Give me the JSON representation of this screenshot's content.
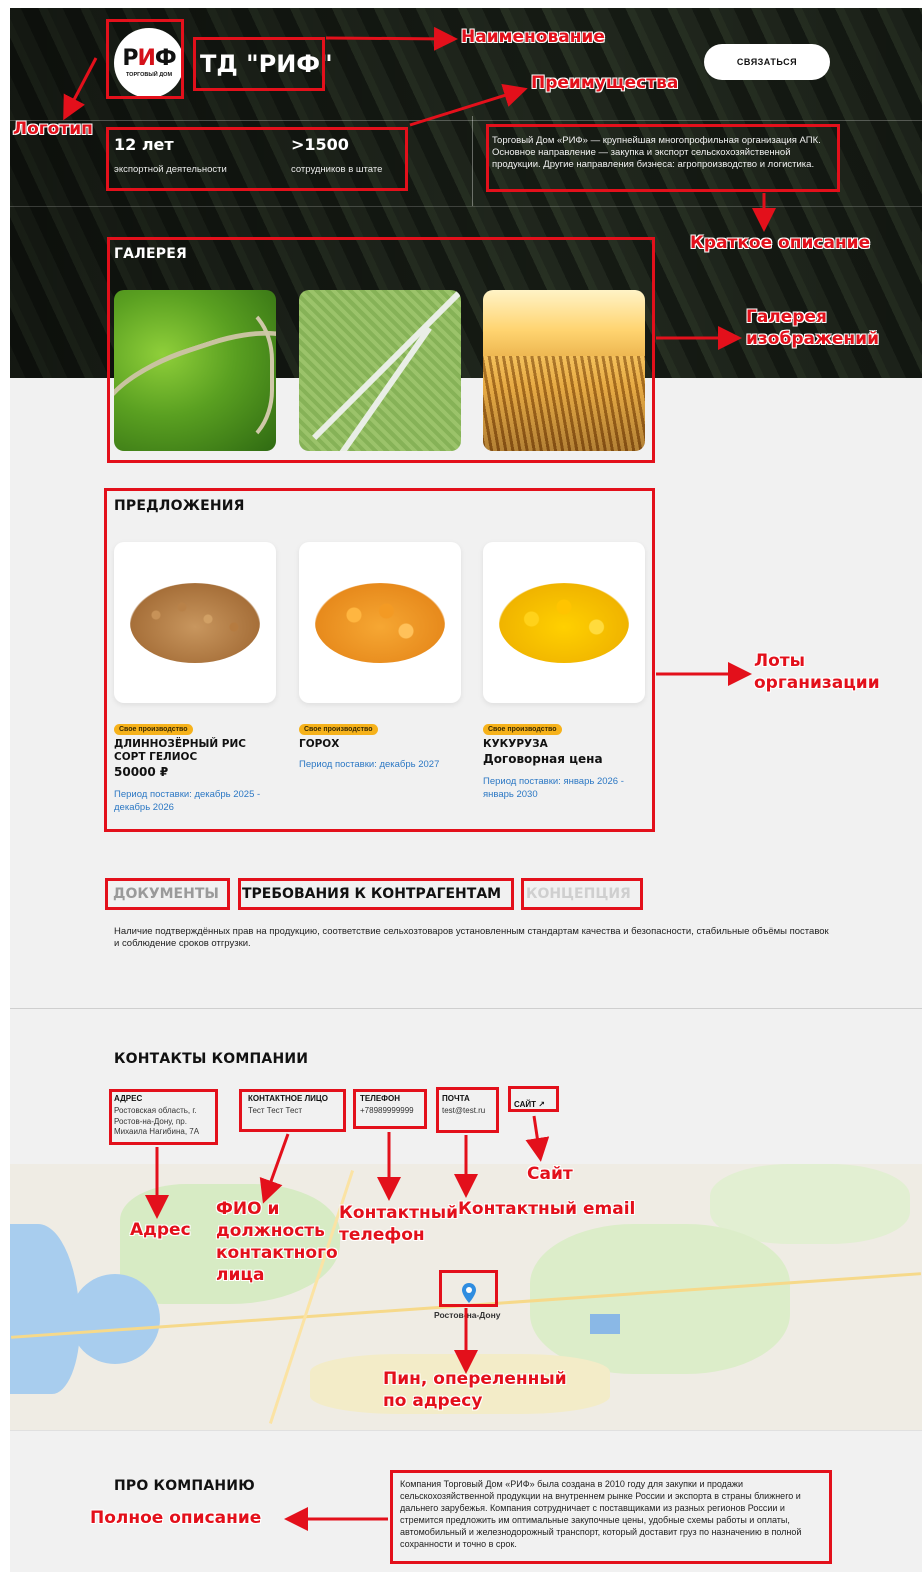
{
  "company": {
    "logo_mark_left": "Р",
    "logo_mark_mid": "И",
    "logo_mark_right": "Ф",
    "logo_subtitle": "ТОРГОВЫЙ ДОМ",
    "name": "ТД \"РИФ\"",
    "contact_button": "СВЯЗАТЬСЯ",
    "short_description": "Торговый Дом «РИФ» — крупнейшая многопрофильная организация АПК. Основное направление — закупка и экспорт сельскохозяйственной продукции. Другие направления бизнеса: агропроизводство и логистика."
  },
  "stats": [
    {
      "value": "12 лет",
      "label": "экспортной деятельности"
    },
    {
      "value": ">1500",
      "label": "сотрудников в штате"
    }
  ],
  "gallery": {
    "title": "ГАЛЕРЕЯ"
  },
  "offers": {
    "title": "ПРЕДЛОЖЕНИЯ",
    "items": [
      {
        "badge": "Свое производство",
        "name": "ДЛИННОЗЁРНЫЙ РИС СОРТ ГЕЛИОС",
        "price": "50000 ₽",
        "period": "Период поставки: декабрь 2025 - декабрь 2026"
      },
      {
        "badge": "Свое производство",
        "name": "ГОРОХ",
        "price": "",
        "period": "Период поставки: декабрь 2027"
      },
      {
        "badge": "Свое производство",
        "name": "КУКУРУЗА",
        "price": "Договорная цена",
        "period": "Период поставки: январь 2026 - январь 2030"
      }
    ]
  },
  "tabs": {
    "documents": "ДОКУМЕНТЫ",
    "requirements": "ТРЕБОВАНИЯ К КОНТРАГЕНТАМ",
    "concept": "КОНЦЕПЦИЯ",
    "content": "Наличие подтверждённых прав на продукцию, соответствие сельхозтоваров установленным стандартам качества и безопасности, стабильные объёмы поставок и соблюдение сроков отгрузки."
  },
  "contacts": {
    "title": "КОНТАКТЫ КОМПАНИИ",
    "address_label": "АДРЕС",
    "address_value": "Ростовская область, г. Ростов-на-Дону, пр. Михаила Нагибина, 7А",
    "person_label": "КОНТАКТНОЕ ЛИЦО",
    "person_value": "Тест Тест Тест",
    "phone_label": "ТЕЛЕФОН",
    "phone_value": "+78989999999",
    "email_label": "ПОЧТА",
    "email_value": "test@test.ru",
    "site_label": "САЙТ ↗"
  },
  "map": {
    "city": "Ростов-на-Дону"
  },
  "about": {
    "title": "ПРО КОМПАНИЮ",
    "text": "Компания Торговый Дом «РИФ» была создана в 2010 году для закупки и продажи сельскохозяйственной продукции на внутреннем рынке России и экспорта в страны ближнего и дальнего зарубежья. Компания сотрудничает с поставщиками из разных регионов России и стремится предложить им оптимальные закупочные цены, удобные схемы работы и оплаты, автомобильный и железнодорожный транспорт, который доставит груз по назначению в полной сохранности и точно в срок."
  },
  "annotations": {
    "name": "Наименование",
    "advantages": "Преимущества",
    "logo": "Логотип",
    "short_desc": "Краткое описание",
    "gallery": "Галерея\nизображений",
    "lots": "Лоты\nорганизации",
    "site": "Сайт",
    "address": "Адрес",
    "person": "ФИО и\nдолжность\nконтактного\nлица",
    "phone": "Контактный\nтелефон",
    "email": "Контактный email",
    "pin": "Пин, опереленный\nпо адресу",
    "full_desc": "Полное описание"
  },
  "colors": {
    "brand_red": "#d5121a",
    "annotation_red": "#e3101b",
    "badge_yellow": "#f6b21b",
    "link_blue": "#2c78c4",
    "pin_blue": "#2f8de0"
  }
}
